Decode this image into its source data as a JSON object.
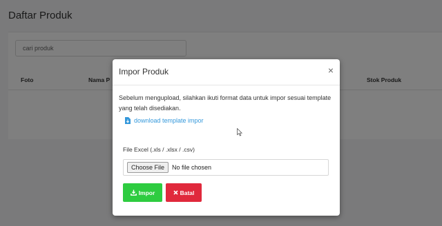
{
  "page": {
    "title": "Daftar Produk",
    "search_placeholder": "cari produk",
    "columns": [
      "Foto",
      "Nama P",
      "Stok Produk"
    ]
  },
  "modal": {
    "title": "Impor Produk",
    "close_symbol": "×",
    "description": "Sebelum mengupload, silahkan ikuti format data untuk impor sesuai template yang telah disediakan.",
    "download_link": "download template impor",
    "file_label": "File Excel (.xls / .xlsx / .csv)",
    "choose_file_label": "Choose File",
    "file_status": "No file chosen",
    "impor_label": "Impor",
    "batal_label": "Batal"
  },
  "colors": {
    "accent": "#3498db",
    "success": "#2ecc40",
    "danger": "#e0293c"
  },
  "icons": [
    "file-download-icon",
    "download-icon",
    "x-icon",
    "mouse-cursor-icon"
  ]
}
